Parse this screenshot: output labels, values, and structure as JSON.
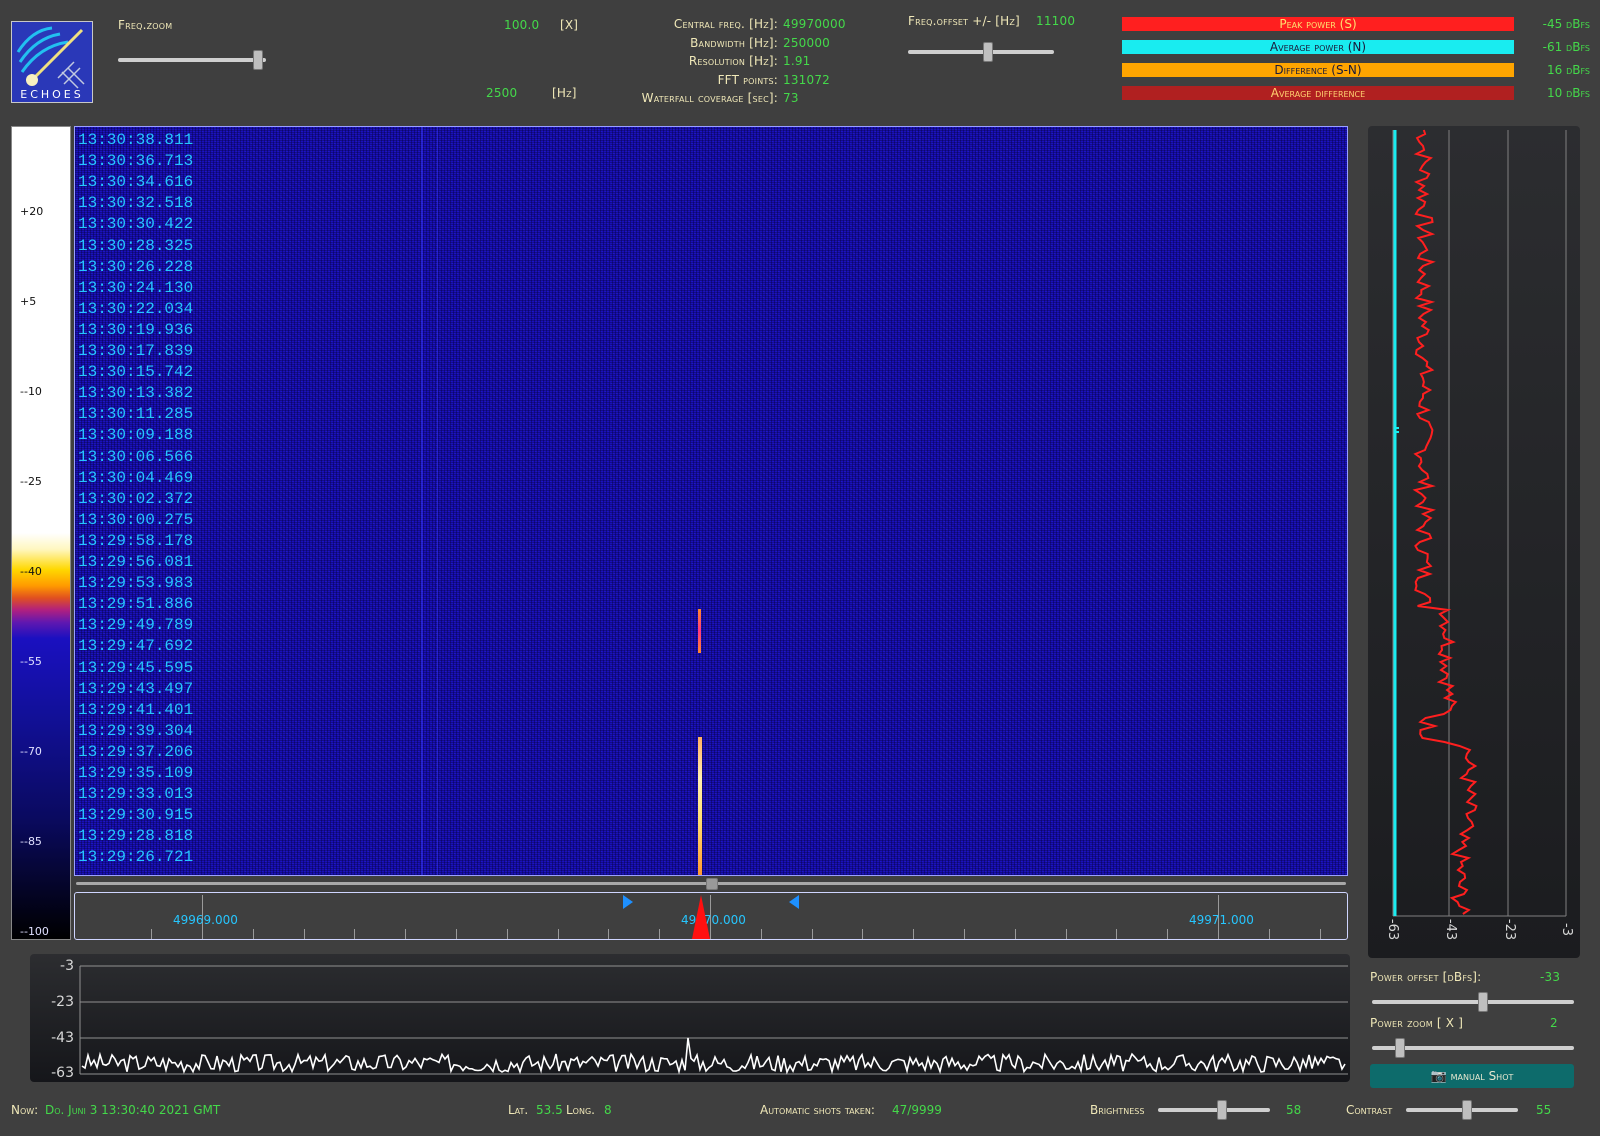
{
  "logo": {
    "text": "ECHOES"
  },
  "freq_zoom": {
    "label": "Freq.zoom",
    "value": "100.0",
    "unit": "[X]",
    "hz_value": "2500",
    "hz_unit": "[Hz]",
    "slider_level": 0.98
  },
  "params": {
    "central_label": "Central freq. [Hz]:",
    "central_value": "49970000",
    "bandwidth_label": "Bandwidth [Hz]:",
    "bandwidth_value": "250000",
    "resolution_label": "Resolution [Hz]:",
    "resolution_value": "1.91",
    "fft_label": "FFT points:",
    "fft_value": "131072",
    "waterfall_label": "Waterfall coverage [sec]:",
    "waterfall_value": "73"
  },
  "freq_offset": {
    "label": "Freq.offset +/- [Hz]",
    "value": "11100",
    "slider_level": 0.55
  },
  "legend": {
    "peak_label": "Peak power (S)",
    "peak_value": "-45 dBfs",
    "peak_color": "#ff1f1f",
    "avg_label": "Average power (N)",
    "avg_value": "-61 dBfs",
    "avg_color": "#19ecf0",
    "diff_label": "Difference (S-N)",
    "diff_value": "16 dBfs",
    "diff_color": "#ffa500",
    "avgdiff_label": "Average difference",
    "avgdiff_value": "10 dBfs",
    "avgdiff_color": "#b02020"
  },
  "color_scale": {
    "labels": [
      "+20",
      "+5",
      "--10",
      "--25",
      "--40",
      "--55",
      "--70",
      "--85",
      "--100"
    ]
  },
  "timestamps": [
    "13:30:38.811",
    "13:30:36.713",
    "13:30:34.616",
    "13:30:32.518",
    "13:30:30.422",
    "13:30:28.325",
    "13:30:26.228",
    "13:30:24.130",
    "13:30:22.034",
    "13:30:19.936",
    "13:30:17.839",
    "13:30:15.742",
    "13:30:13.382",
    "13:30:11.285",
    "13:30:09.188",
    "13:30:06.566",
    "13:30:04.469",
    "13:30:02.372",
    "13:30:00.275",
    "13:29:58.178",
    "13:29:56.081",
    "13:29:53.983",
    "13:29:51.886",
    "13:29:49.789",
    "13:29:47.692",
    "13:29:45.595",
    "13:29:43.497",
    "13:29:41.401",
    "13:29:39.304",
    "13:29:37.206",
    "13:29:35.109",
    "13:29:33.013",
    "13:29:30.915",
    "13:29:28.818",
    "13:29:26.721"
  ],
  "freq_axis": {
    "labels": [
      "49969.000",
      "49970.000",
      "49971.000"
    ]
  },
  "power_panel": {
    "ticks": [
      "-63",
      "-43",
      "-23",
      "-3"
    ]
  },
  "spectrum": {
    "ticks": [
      "-3",
      "-23",
      "-43",
      "-63"
    ]
  },
  "power_offset": {
    "label": "Power offset [dBfs]:",
    "value": "-33",
    "slider_level": 0.55
  },
  "power_zoom": {
    "label": "Power zoom [ X ]",
    "value": "2",
    "slider_level": 0.12
  },
  "manual_shot": {
    "label": "manual Shot"
  },
  "status": {
    "now_label": "Now:",
    "now_value": "Do. Juni 3 13:30:40 2021 GMT",
    "lat_label": "Lat.",
    "lat_value": "53.5",
    "long_label": "Long.",
    "long_value": "8",
    "shots_label": "Automatic shots taken:",
    "shots_value": "47/9999"
  },
  "brightness": {
    "label": "Brightness",
    "value": "58",
    "slider_level": 0.58
  },
  "contrast": {
    "label": "Contrast",
    "value": "55",
    "slider_level": 0.55
  }
}
